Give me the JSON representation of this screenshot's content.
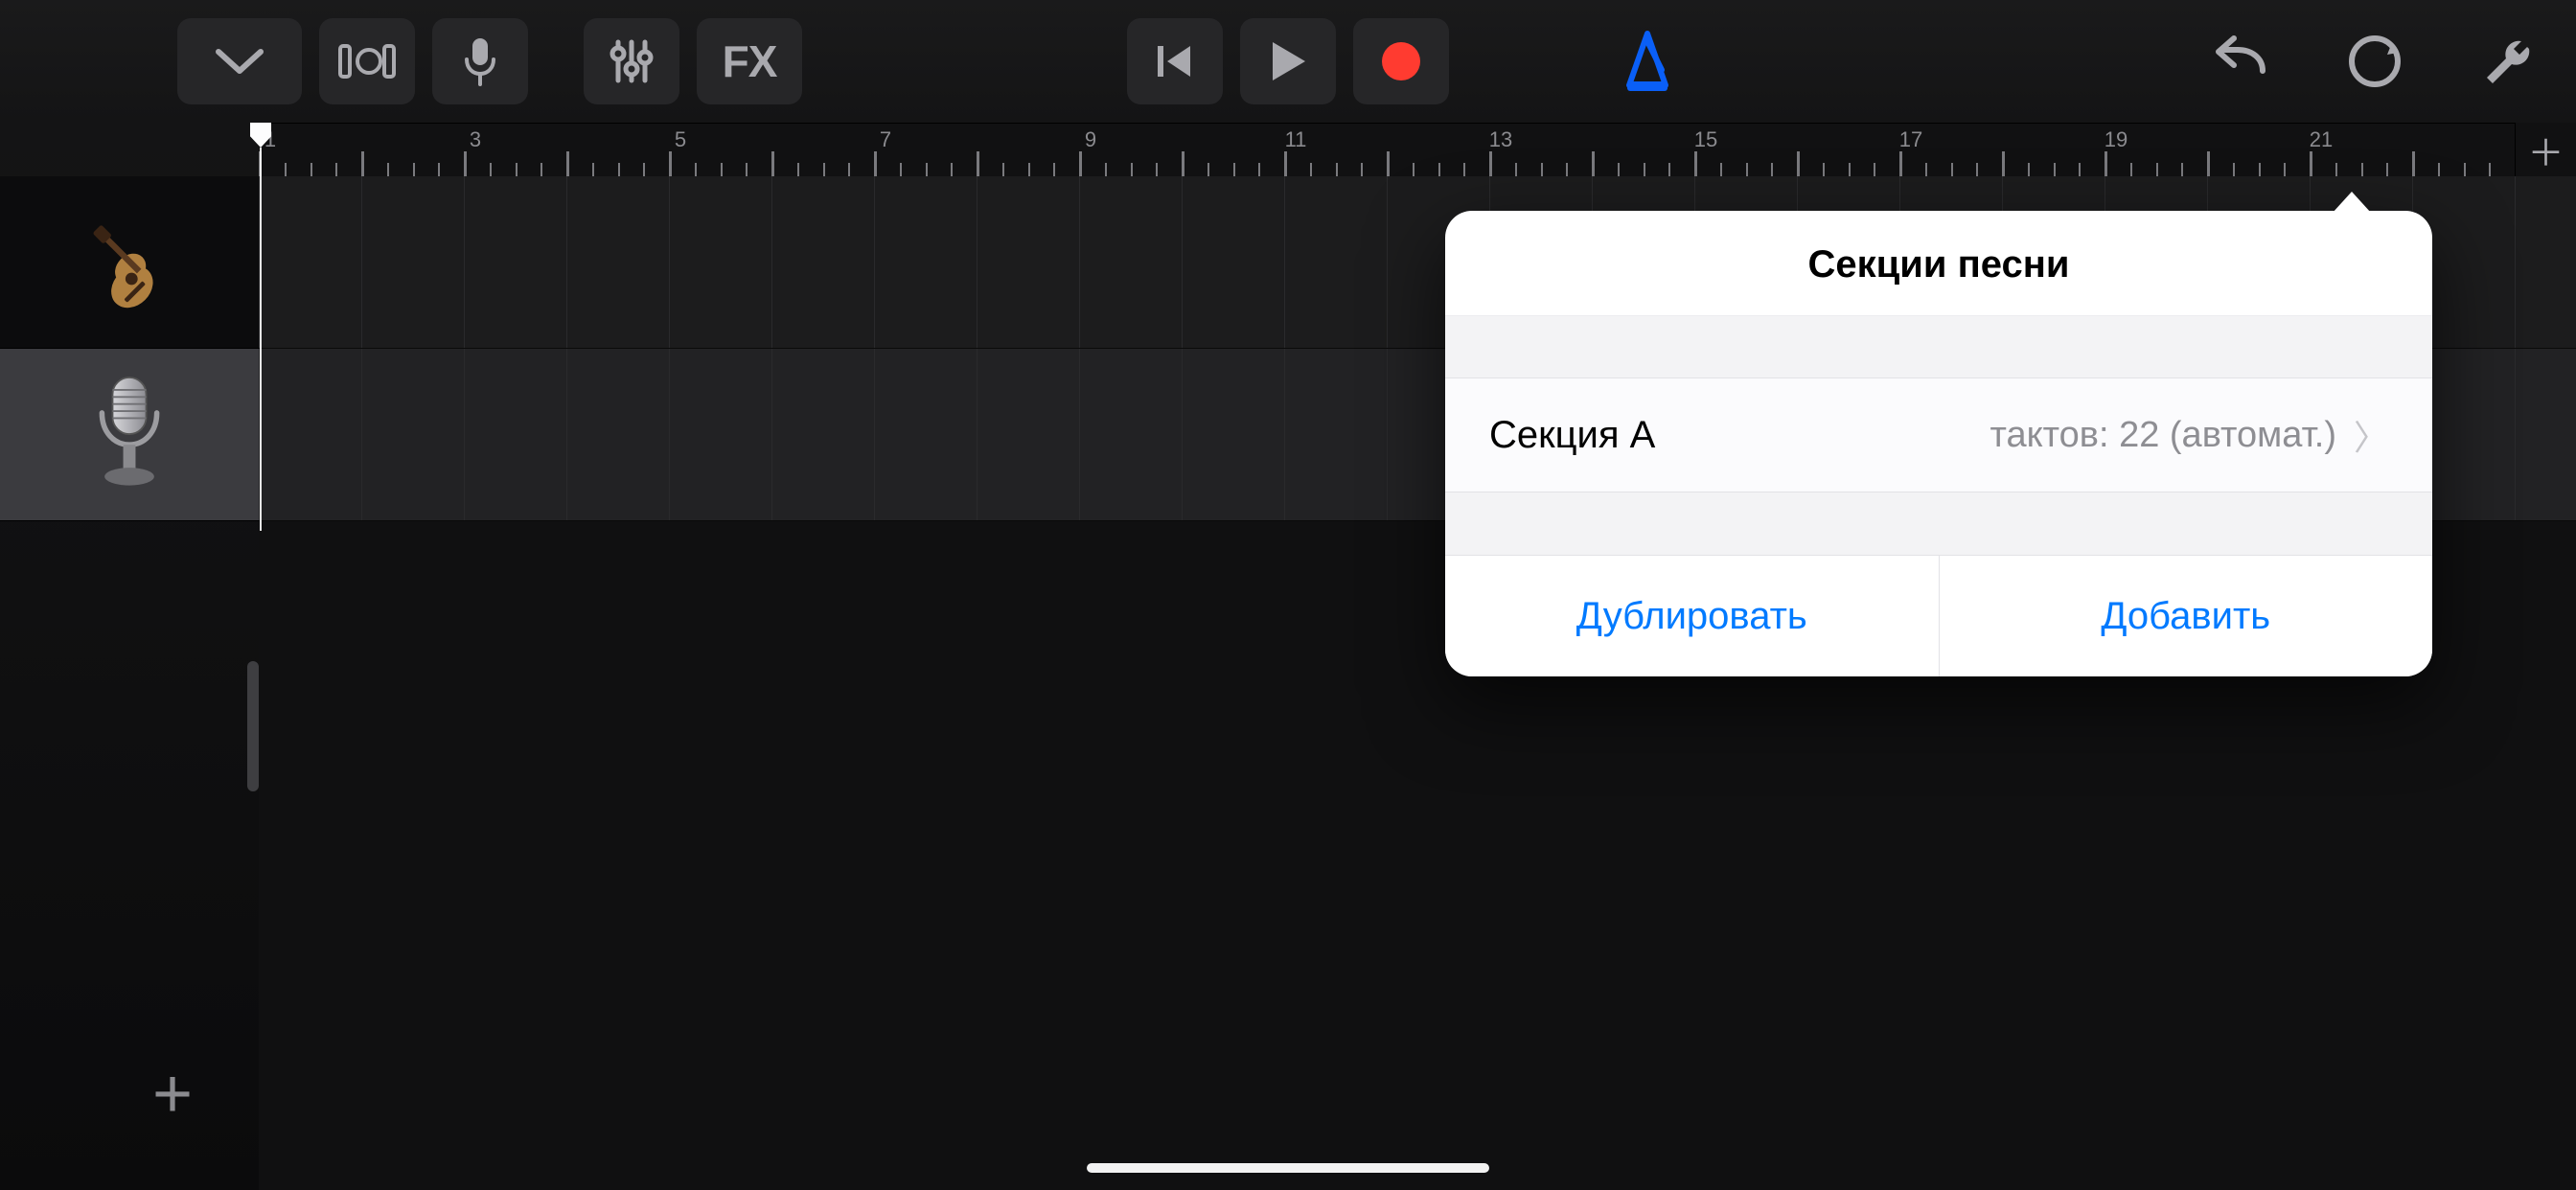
{
  "toolbar": {
    "fx_label": "FX"
  },
  "ruler": {
    "start": 1,
    "end": 22,
    "labeled_interval": 2,
    "labels": [
      1,
      3,
      5,
      7,
      9,
      11,
      13,
      15,
      17,
      19,
      21
    ],
    "subdivisions": 4,
    "playhead_at": 1
  },
  "tracks": [
    {
      "id": "guitar",
      "selected": false
    },
    {
      "id": "mic",
      "selected": true
    }
  ],
  "popover": {
    "title": "Секции песни",
    "section_label": "Секция A",
    "section_detail": "тактов: 22 (автомат.)",
    "action_duplicate": "Дублировать",
    "action_add": "Добавить"
  }
}
